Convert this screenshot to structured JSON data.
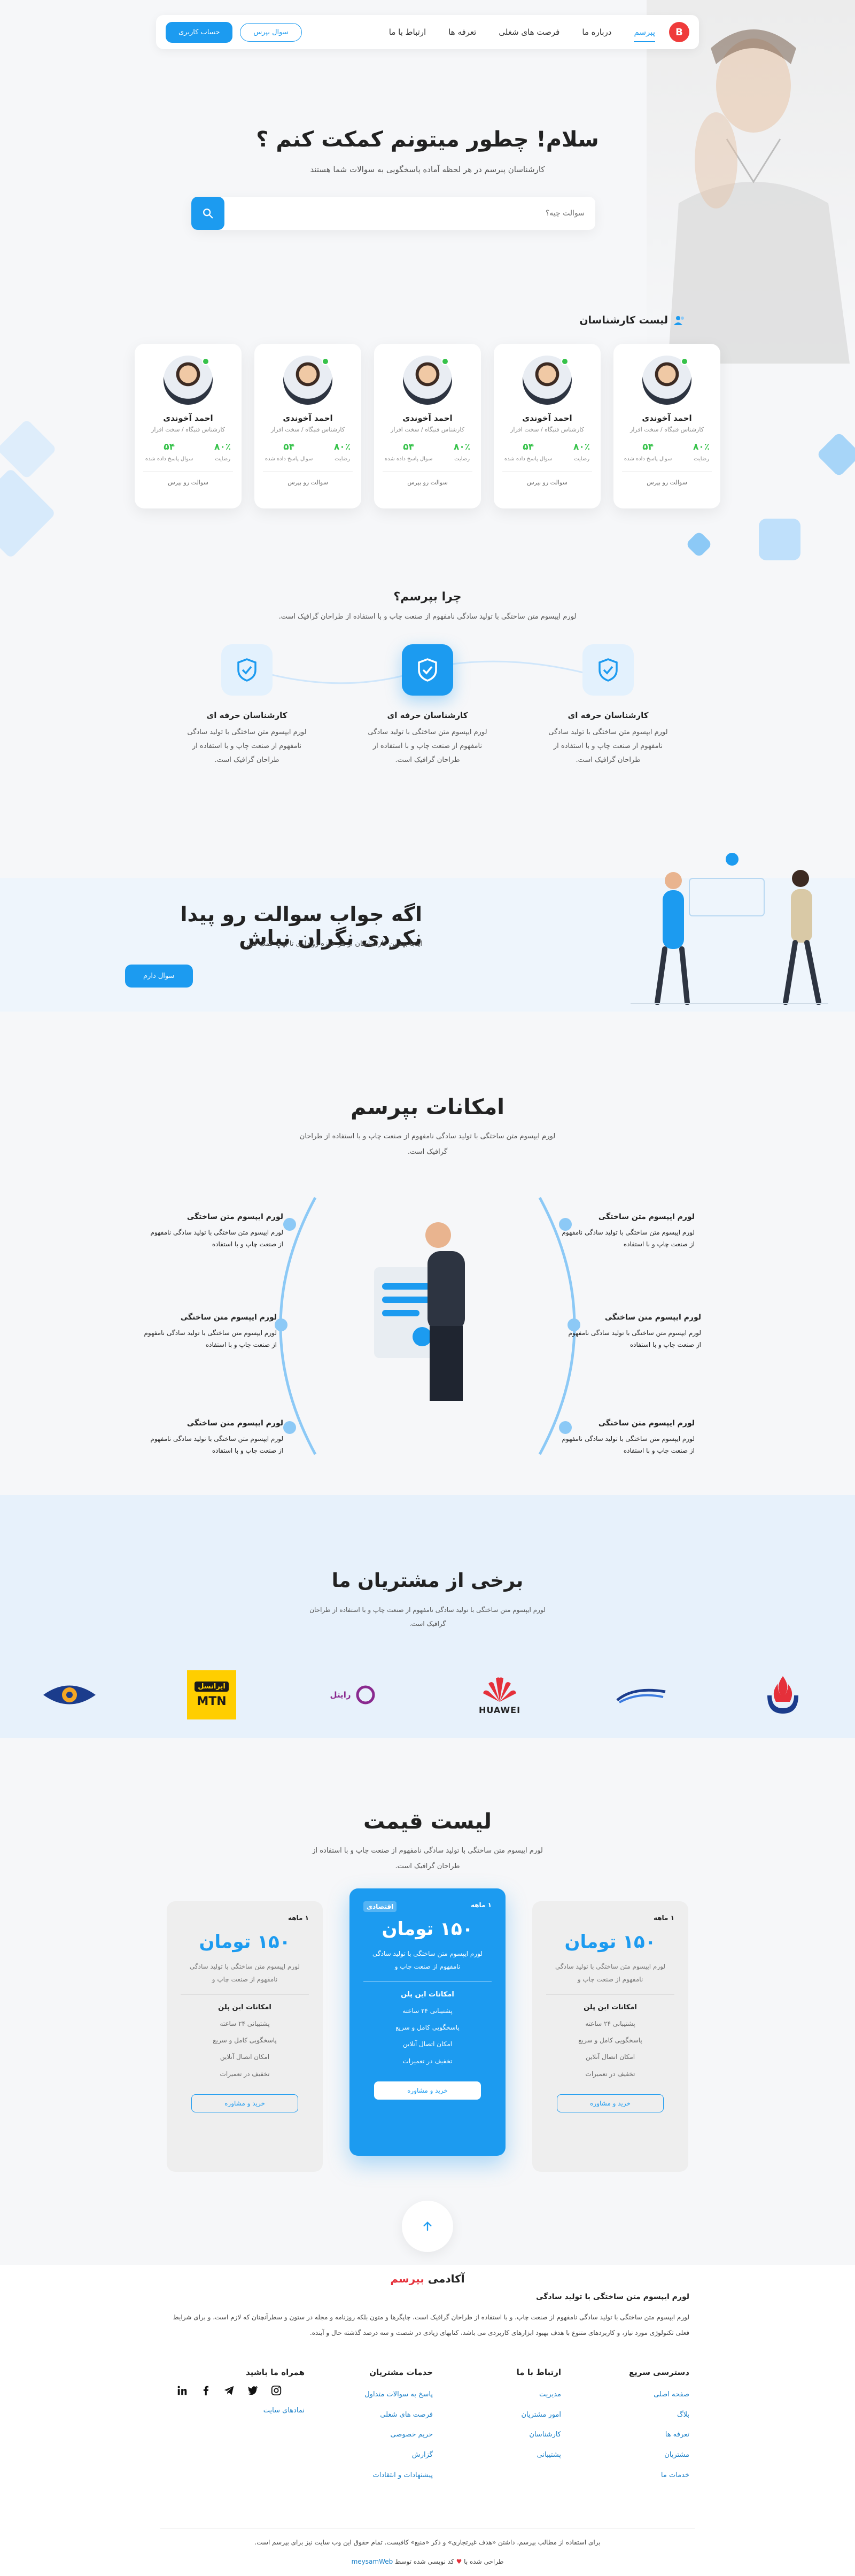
{
  "nav": {
    "logo": "B",
    "items": [
      "پبرسم",
      "درباره ما",
      "فرصت های شغلی",
      "تعرفه ها",
      "ارتباط با ما"
    ],
    "ask_button": "سوال بپرس",
    "account_button": "حساب کاربری"
  },
  "hero": {
    "title": "سلام! چطور میتونم کمکت کنم ؟",
    "subtitle": "کارشناسان پبرسم در هر لحظه آماده پاسخگویی به سوالات شما هستند",
    "search_placeholder": "سوالت چیه؟"
  },
  "experts": {
    "heading": "لیست کارشناسان",
    "cards": [
      {
        "name": "احمد آخوندی",
        "role": "کارشناس فنبگاه / سخت افزار",
        "stat1_value": "۸۰٪",
        "stat1_label": "رضایت",
        "stat2_value": "۵۴",
        "stat2_label": "سوال پاسخ داده شده",
        "cta": "سوالت رو بپرس"
      },
      {
        "name": "احمد آخوندی",
        "role": "کارشناس فنبگاه / سخت افزار",
        "stat1_value": "۸۰٪",
        "stat1_label": "رضایت",
        "stat2_value": "۵۴",
        "stat2_label": "سوال پاسخ داده شده",
        "cta": "سوالت رو بپرس"
      },
      {
        "name": "احمد آخوندی",
        "role": "کارشناس فنبگاه / سخت افزار",
        "stat1_value": "۸۰٪",
        "stat1_label": "رضایت",
        "stat2_value": "۵۴",
        "stat2_label": "سوال پاسخ داده شده",
        "cta": "سوالت رو بپرس"
      },
      {
        "name": "احمد آخوندی",
        "role": "کارشناس فنبگاه / سخت افزار",
        "stat1_value": "۸۰٪",
        "stat1_label": "رضایت",
        "stat2_value": "۵۴",
        "stat2_label": "سوال پاسخ داده شده",
        "cta": "سوالت رو بپرس"
      },
      {
        "name": "احمد آخوندی",
        "role": "کارشناس فنبگاه / سخت افزار",
        "stat1_value": "۸۰٪",
        "stat1_label": "رضایت",
        "stat2_value": "۵۴",
        "stat2_label": "سوال پاسخ داده شده",
        "cta": "سوالت رو بپرس"
      }
    ]
  },
  "why": {
    "title": "چرا بپرسم؟",
    "subtitle": "لورم ایپسوم متن ساختگی با تولید سادگی نامفهوم از صنعت چاپ و با استفاده از طراحان گرافیک است.",
    "features": [
      {
        "title": "کارشناسان حرفه ای",
        "text": "لورم ایپسوم متن ساختگی با تولید سادگی نامفهوم از صنعت چاپ و با استفاده از طراحان گرافیک است."
      },
      {
        "title": "کارشناسان حرفه ای",
        "text": "لورم ایپسوم متن ساختگی با تولید سادگی نامفهوم از صنعت چاپ و با استفاده از طراحان گرافیک است."
      },
      {
        "title": "کارشناسان حرفه ای",
        "text": "لورم ایپسوم متن ساختگی با تولید سادگی نامفهوم از صنعت چاپ و با استفاده از طراحان گرافیک است."
      }
    ]
  },
  "cta_band": {
    "title": "اگه جواب سوالت رو پیدا نکردی نگران نباش",
    "subtitle": "اینجا بهترین کارشناسان از هر حوزه رو داری تا بهت کمک کنن",
    "button": "سوال دارم"
  },
  "features": {
    "title": "امکانات بپرسم",
    "subtitle": "لورم ایپسوم متن ساختگی با تولید سادگی نامفهوم از صنعت چاپ و با استفاده از طراحان گرافیک است.",
    "items": [
      {
        "title": "لورم ایپسوم متن ساختگی",
        "text": "لورم ایپسوم متن ساختگی با تولید سادگی نامفهوم از صنعت چاپ و با استفاده"
      },
      {
        "title": "لورم ایپسوم متن ساختگی",
        "text": "لورم ایپسوم متن ساختگی با تولید سادگی نامفهوم از صنعت چاپ و با استفاده"
      },
      {
        "title": "لورم ایپسوم متن ساختگی",
        "text": "لورم ایپسوم متن ساختگی با تولید سادگی نامفهوم از صنعت چاپ و با استفاده"
      },
      {
        "title": "لورم ایپسوم متن ساختگی",
        "text": "لورم ایپسوم متن ساختگی با تولید سادگی نامفهوم از صنعت چاپ و با استفاده"
      },
      {
        "title": "لورم ایپسوم متن ساختگی",
        "text": "لورم ایپسوم متن ساختگی با تولید سادگی نامفهوم از صنعت چاپ و با استفاده"
      },
      {
        "title": "لورم ایپسوم متن ساختگی",
        "text": "لورم ایپسوم متن ساختگی با تولید سادگی نامفهوم از صنعت چاپ و با استفاده"
      }
    ]
  },
  "clients": {
    "title": "برخی از مشتریان ما",
    "subtitle": "لورم ایپسوم متن ساختگی با تولید سادگی نامفهوم از صنعت چاپ و با استفاده از طراحان گرافیک است.",
    "logos": [
      "HUAWEI",
      "رایتل",
      "ایرانسل MTN"
    ],
    "irancell_label": "ایرانسل",
    "mtn_label": "MTN",
    "rightel_label": "رایتل",
    "huawei_label": "HUAWEI"
  },
  "pricing": {
    "title": "لیست قیمت",
    "subtitle": "لورم ایپسوم متن ساختگی با تولید سادگی نامفهوم از صنعت چاپ و با استفاده از طراحان گرافیک است.",
    "plans": [
      {
        "period": "۱ ماهه",
        "price": "۱۵۰ تومان",
        "desc": "لورم ایپسوم متن ساختگی با تولید سادگی نامفهوم از صنعت چاپ و",
        "features_title": "امکانات این پلن",
        "features": [
          "پشتیبانی ۲۴ ساعته",
          "پاسخگویی کامل و سریع",
          "امکان اتصال آنلاین",
          "تخفیف در تعمیرات"
        ],
        "button": "خرید و مشاوره"
      },
      {
        "period": "۱ ماهه",
        "badge": "اقتصادی",
        "price": "۱۵۰ تومان",
        "desc": "لورم ایپسوم متن ساختگی با تولید سادگی نامفهوم از صنعت چاپ و",
        "features_title": "امکانات این پلن",
        "features": [
          "پشتیبانی ۲۴ ساعته",
          "پاسخگویی کامل و سریع",
          "امکان اتصال آنلاین",
          "تخفیف در تعمیرات"
        ],
        "button": "خرید و مشاوره"
      },
      {
        "period": "۱ ماهه",
        "price": "۱۵۰ تومان",
        "desc": "لورم ایپسوم متن ساختگی با تولید سادگی نامفهوم از صنعت چاپ و",
        "features_title": "امکانات این پلن",
        "features": [
          "پشتیبانی ۲۴ ساعته",
          "پاسخگویی کامل و سریع",
          "امکان اتصال آنلاین",
          "تخفیف در تعمیرات"
        ],
        "button": "خرید و مشاوره"
      }
    ]
  },
  "footer": {
    "title_prefix": "آکادمی",
    "title_brand": "بپرسم",
    "heading": "لورم ایپسوم متن ساختگی با تولید سادگی",
    "paragraph": "لورم ایپسوم متن ساختگی با تولید سادگی نامفهوم از صنعت چاپ، و با استفاده از طراحان گرافیک است، چاپگرها و متون بلکه روزنامه و مجله در ستون و سطرآنچنان که لازم است، و برای شرایط فعلی تکنولوژی مورد نیاز، و کاربردهای متنوع با هدف بهبود ابزارهای کاربردی می باشد، کتابهای زیادی در شصت و سه درصد گذشته حال و آینده.",
    "columns": [
      {
        "title": "دسترسی سریع",
        "links": [
          "صفحه اصلی",
          "بلاگ",
          "تعرفه ها",
          "مشتریان",
          "خدمات ما"
        ]
      },
      {
        "title": "ارتباط با ما",
        "links": [
          "مدیریت",
          "امور مشتریان",
          "کارشناسان",
          "پشتیبانی"
        ]
      },
      {
        "title": "خدمات مشتریان",
        "links": [
          "پاسخ به سوالات متداول",
          "فرصت های شغلی",
          "حریم خصوصی",
          "گزارش",
          "پیشنهادات و انتقادات"
        ]
      },
      {
        "title": "همراه ما باشید",
        "links": [
          "نمادهای سایت"
        ]
      }
    ],
    "copyright": "برای استفاده از مطالب بپرسم، داشتن «هدف غیرتجاری» و ذکر «منبع» کافیست. تمام حقوق این وب سایت نیز برای بپرسم است.",
    "credit_prefix": "طراحی شده با",
    "credit_mid": "کد نویسی شده توسط",
    "credit_author": "meysamWeb"
  }
}
